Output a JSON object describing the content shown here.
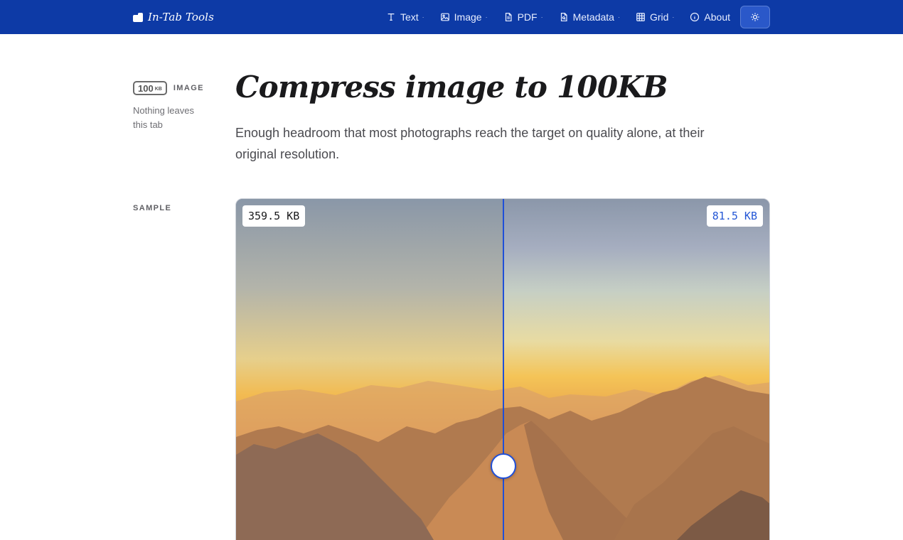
{
  "header": {
    "brand": "In-Tab Tools",
    "nav": [
      {
        "label": "Text",
        "icon": "text-icon",
        "dot": "·"
      },
      {
        "label": "Image",
        "icon": "image-icon",
        "dot": "·"
      },
      {
        "label": "PDF",
        "icon": "file-icon",
        "dot": "·"
      },
      {
        "label": "Metadata",
        "icon": "file-search-icon",
        "dot": "·"
      },
      {
        "label": "Grid",
        "icon": "grid-icon",
        "dot": "·"
      },
      {
        "label": "About",
        "icon": "info-icon"
      }
    ],
    "theme_icon": "sun-icon"
  },
  "meta": {
    "badge_number": "100",
    "badge_unit": "KB",
    "category": "IMAGE",
    "note": "Nothing leaves this tab",
    "sample_label": "SAMPLE"
  },
  "main": {
    "title": "Compress image to 100KB",
    "lede": "Enough headroom that most photographs reach the target on quality alone, at their original resolution."
  },
  "compare": {
    "original_size": "359.5 KB",
    "compressed_size": "81.5 KB",
    "split_fraction": 0.5
  },
  "colors": {
    "header_bg": "#0d3aa6",
    "accent": "#1f4fd8",
    "compressed_label": "#2457d6"
  }
}
